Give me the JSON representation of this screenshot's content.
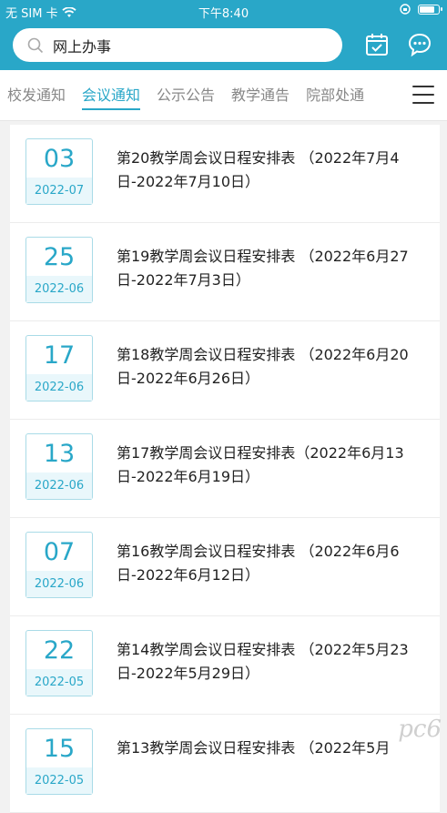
{
  "status_bar": {
    "carrier": "无 SIM 卡",
    "time": "下午8:40"
  },
  "search": {
    "text": "网上办事"
  },
  "tabs": [
    {
      "label": "校发通知"
    },
    {
      "label": "会议通知"
    },
    {
      "label": "公示公告"
    },
    {
      "label": "教学通告"
    },
    {
      "label": "院部处通"
    }
  ],
  "active_tab": 1,
  "items": [
    {
      "day": "03",
      "month": "2022-07",
      "title": "第20教学周会议日程安排表 （2022年7月4日-2022年7月10日）"
    },
    {
      "day": "25",
      "month": "2022-06",
      "title": "第19教学周会议日程安排表 （2022年6月27日-2022年7月3日）"
    },
    {
      "day": "17",
      "month": "2022-06",
      "title": "第18教学周会议日程安排表 （2022年6月20日-2022年6月26日）"
    },
    {
      "day": "13",
      "month": "2022-06",
      "title": "第17教学周会议日程安排表（2022年6月13日-2022年6月19日）"
    },
    {
      "day": "07",
      "month": "2022-06",
      "title": "第16教学周会议日程安排表 （2022年6月6日-2022年6月12日）"
    },
    {
      "day": "22",
      "month": "2022-05",
      "title": "第14教学周会议日程安排表 （2022年5月23日-2022年5月29日）"
    },
    {
      "day": "15",
      "month": "2022-05",
      "title": "第13教学周会议日程安排表 （2022年5月"
    }
  ],
  "watermark": "pc6",
  "colors": {
    "accent": "#29a7c8",
    "date_border": "#a9dbe7",
    "date_bg": "#e9f7fb"
  }
}
